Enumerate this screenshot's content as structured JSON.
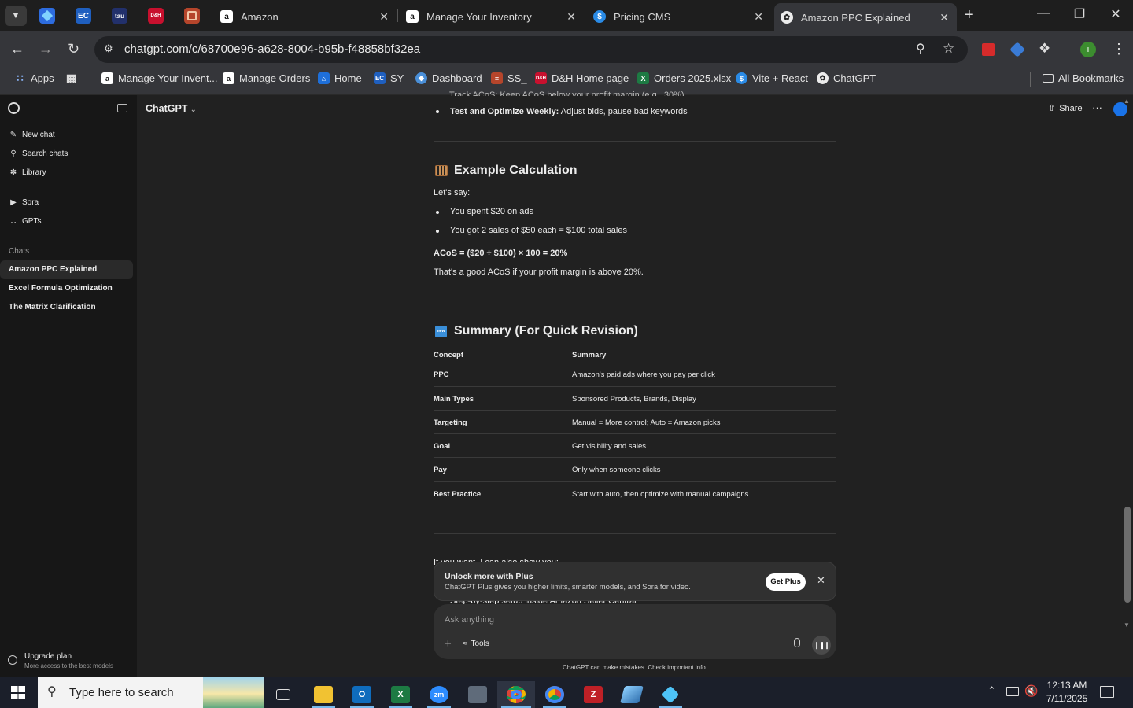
{
  "browser": {
    "tabs": [
      {
        "title": "Amazon",
        "favicon": "amazon-icon"
      },
      {
        "title": "Manage Your Inventory",
        "favicon": "amazon-icon"
      },
      {
        "title": "Pricing CMS",
        "favicon": "dollar-icon"
      },
      {
        "title": "Amazon PPC Explained",
        "favicon": "chatgpt-icon",
        "active": true
      }
    ],
    "pinned_tabs": [
      {
        "label": "EC"
      },
      {
        "label": "tau"
      },
      {
        "label": "D&H"
      }
    ],
    "url": "chatgpt.com/c/68700e96-a628-8004-b95b-f48858bf32ea",
    "avatar_letter": "i"
  },
  "bookmarks": {
    "items": [
      {
        "label": "Apps"
      },
      {
        "label": "Manage Your Invent..."
      },
      {
        "label": "Manage Orders"
      },
      {
        "label": "Home"
      },
      {
        "label": "SY"
      },
      {
        "label": "Dashboard"
      },
      {
        "label": "SS_"
      },
      {
        "label": "D&H Home page"
      },
      {
        "label": "Orders 2025.xlsx"
      },
      {
        "label": "Vite + React"
      },
      {
        "label": "ChatGPT"
      }
    ],
    "all_bookmarks": "All Bookmarks",
    "icon_labels": {
      "ec": "EC",
      "dh": "D&H",
      "excel": "X",
      "vite": "$"
    }
  },
  "sidebar": {
    "new_chat": "New chat",
    "search_chats": "Search chats",
    "library": "Library",
    "sora": "Sora",
    "gpts": "GPTs",
    "chats_heading": "Chats",
    "chats": [
      {
        "label": "Amazon PPC Explained",
        "active": true
      },
      {
        "label": "Excel Formula Optimization"
      },
      {
        "label": "The Matrix Clarification"
      }
    ],
    "upgrade_title": "Upgrade plan",
    "upgrade_sub": "More access to the best models"
  },
  "header": {
    "model": "ChatGPT",
    "share": "Share",
    "more": "···"
  },
  "content": {
    "top_bullet_label": "Test and Optimize Weekly:",
    "top_bullet_text": " Adjust bids, pause bad keywords",
    "example_heading": "Example Calculation",
    "lets_say": "Let's say:",
    "bullets": [
      "You spent $20 on ads",
      "You got 2 sales of $50 each = $100 total sales"
    ],
    "acos_formula": "ACoS = ($20 ÷ $100) × 100 = 20%",
    "acos_note": "That's a good ACoS if your profit margin is above 20%.",
    "summary_heading": "Summary (For Quick Revision)",
    "table": {
      "headers": [
        "Concept",
        "Summary"
      ],
      "rows": [
        [
          "PPC",
          "Amazon's paid ads where you pay per click"
        ],
        [
          "Main Types",
          "Sponsored Products, Brands, Display"
        ],
        [
          "Targeting",
          "Manual = More control; Auto = Amazon picks"
        ],
        [
          "Goal",
          "Get visibility and sales"
        ],
        [
          "Pay",
          "Only when someone clicks"
        ],
        [
          "Best Practice",
          "Start with auto, then optimize with manual campaigns"
        ]
      ]
    },
    "partial_text": "If you want, I can also show you:",
    "partial_bullet": "Step-by-step setup inside Amazon Seller Central"
  },
  "plus_banner": {
    "title": "Unlock more with Plus",
    "text": "ChatGPT Plus gives you higher limits, smarter models, and Sora for video.",
    "button": "Get Plus"
  },
  "composer": {
    "placeholder": "Ask anything",
    "tools": "Tools",
    "disclaimer": "ChatGPT can make mistakes. Check important info."
  },
  "taskbar": {
    "search_placeholder": "Type here to search",
    "time": "12:13 AM",
    "date": "7/11/2025",
    "app_labels": {
      "outlook": "O",
      "excel": "X",
      "zoom": "zm",
      "filezilla": "Z"
    }
  },
  "colors": {
    "active_tab": "#35363a",
    "page_bg": "#212121",
    "sidebar_bg": "#171717",
    "accent_blue": "#1a73e8",
    "banner_bg": "#303030"
  }
}
